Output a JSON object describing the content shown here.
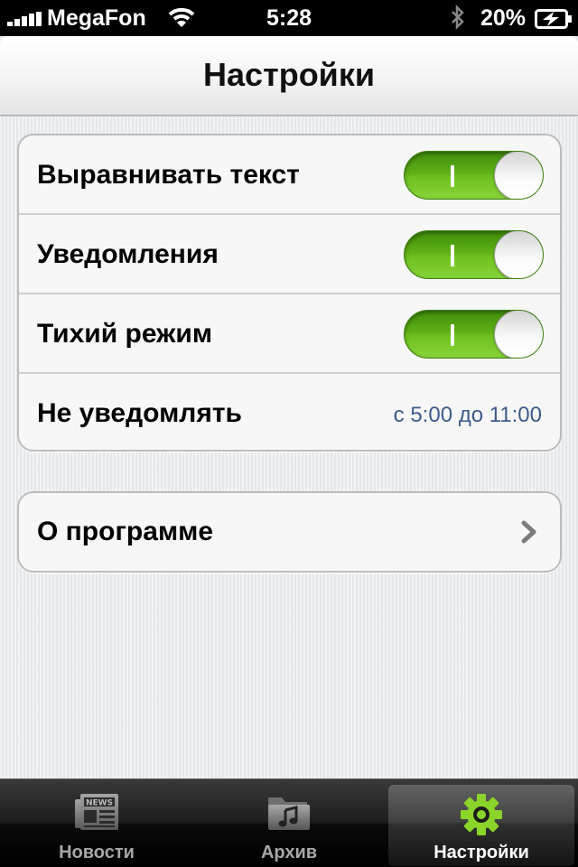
{
  "status_bar": {
    "carrier": "MegaFon",
    "time": "5:28",
    "battery_percent": "20%",
    "signal_bars": 5,
    "icons": [
      "signal-bars-icon",
      "wifi-icon",
      "bluetooth-icon",
      "battery-charging-icon"
    ]
  },
  "nav": {
    "title": "Настройки"
  },
  "settings": {
    "rows": [
      {
        "label": "Выравнивать текст",
        "toggle_on": true
      },
      {
        "label": "Уведомления",
        "toggle_on": true
      },
      {
        "label": "Тихий режим",
        "toggle_on": true
      },
      {
        "label": "Не уведомлять",
        "detail": "с 5:00 до 11:00"
      }
    ]
  },
  "about": {
    "label": "О программе",
    "icon": "chevron-right-icon"
  },
  "tabbar": {
    "tabs": [
      {
        "label": "Новости",
        "icon": "news-icon",
        "active": false
      },
      {
        "label": "Архив",
        "icon": "archive-folder-icon",
        "active": false
      },
      {
        "label": "Настройки",
        "icon": "gear-icon",
        "active": true
      }
    ]
  },
  "colors": {
    "toggle_on": "#5eb116",
    "detail_text": "#3d5a8c",
    "active_tab_icon": "#8bd42a"
  }
}
